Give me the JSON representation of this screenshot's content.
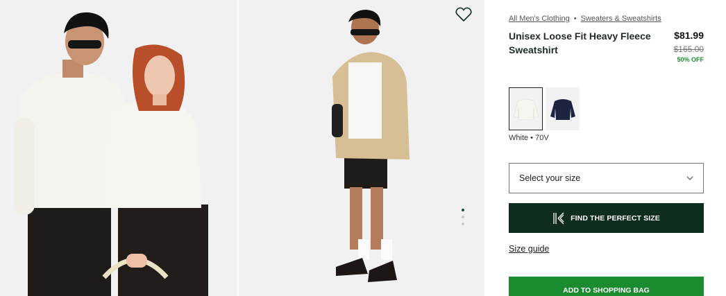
{
  "gallery": {
    "images": [
      {
        "alt": "Two models wearing white Unisex Loose Fit Heavy Fleece Sweatshirt with black shorts"
      },
      {
        "alt": "Model wearing white sweatshirt under beige jacket with black shorts and sneakers"
      }
    ],
    "active_index": 0,
    "dot_count": 3,
    "wishlist_icon": "heart-outline-icon"
  },
  "breadcrumb": {
    "items": [
      "All Men's Clothing",
      "Sweaters & Sweatshirts"
    ],
    "separator": "•"
  },
  "product": {
    "title": "Unisex Loose Fit Heavy Fleece Sweatshirt",
    "price": "$81.99",
    "original_price": "$165.00",
    "discount": "50% OFF"
  },
  "colors": {
    "swatches": [
      {
        "name": "White",
        "code": "70V",
        "hex": "#f4f1ea",
        "selected": true
      },
      {
        "name": "Navy",
        "hex": "#1d2440",
        "selected": false
      }
    ],
    "selected_label": "White • 70V"
  },
  "size": {
    "placeholder": "Select your size",
    "chevron_icon": "chevron-down-icon"
  },
  "fit_finder": {
    "label": "FIND THE PERFECT SIZE",
    "icon": "kiwi-sizing-icon"
  },
  "size_guide": {
    "label": "Size guide"
  },
  "cart": {
    "label": "ADD TO SHOPPING BAG"
  },
  "theme": {
    "dark_green": "#0e2d1d",
    "brand_green": "#1a8b2f",
    "discount_green": "#1b8a2c"
  }
}
